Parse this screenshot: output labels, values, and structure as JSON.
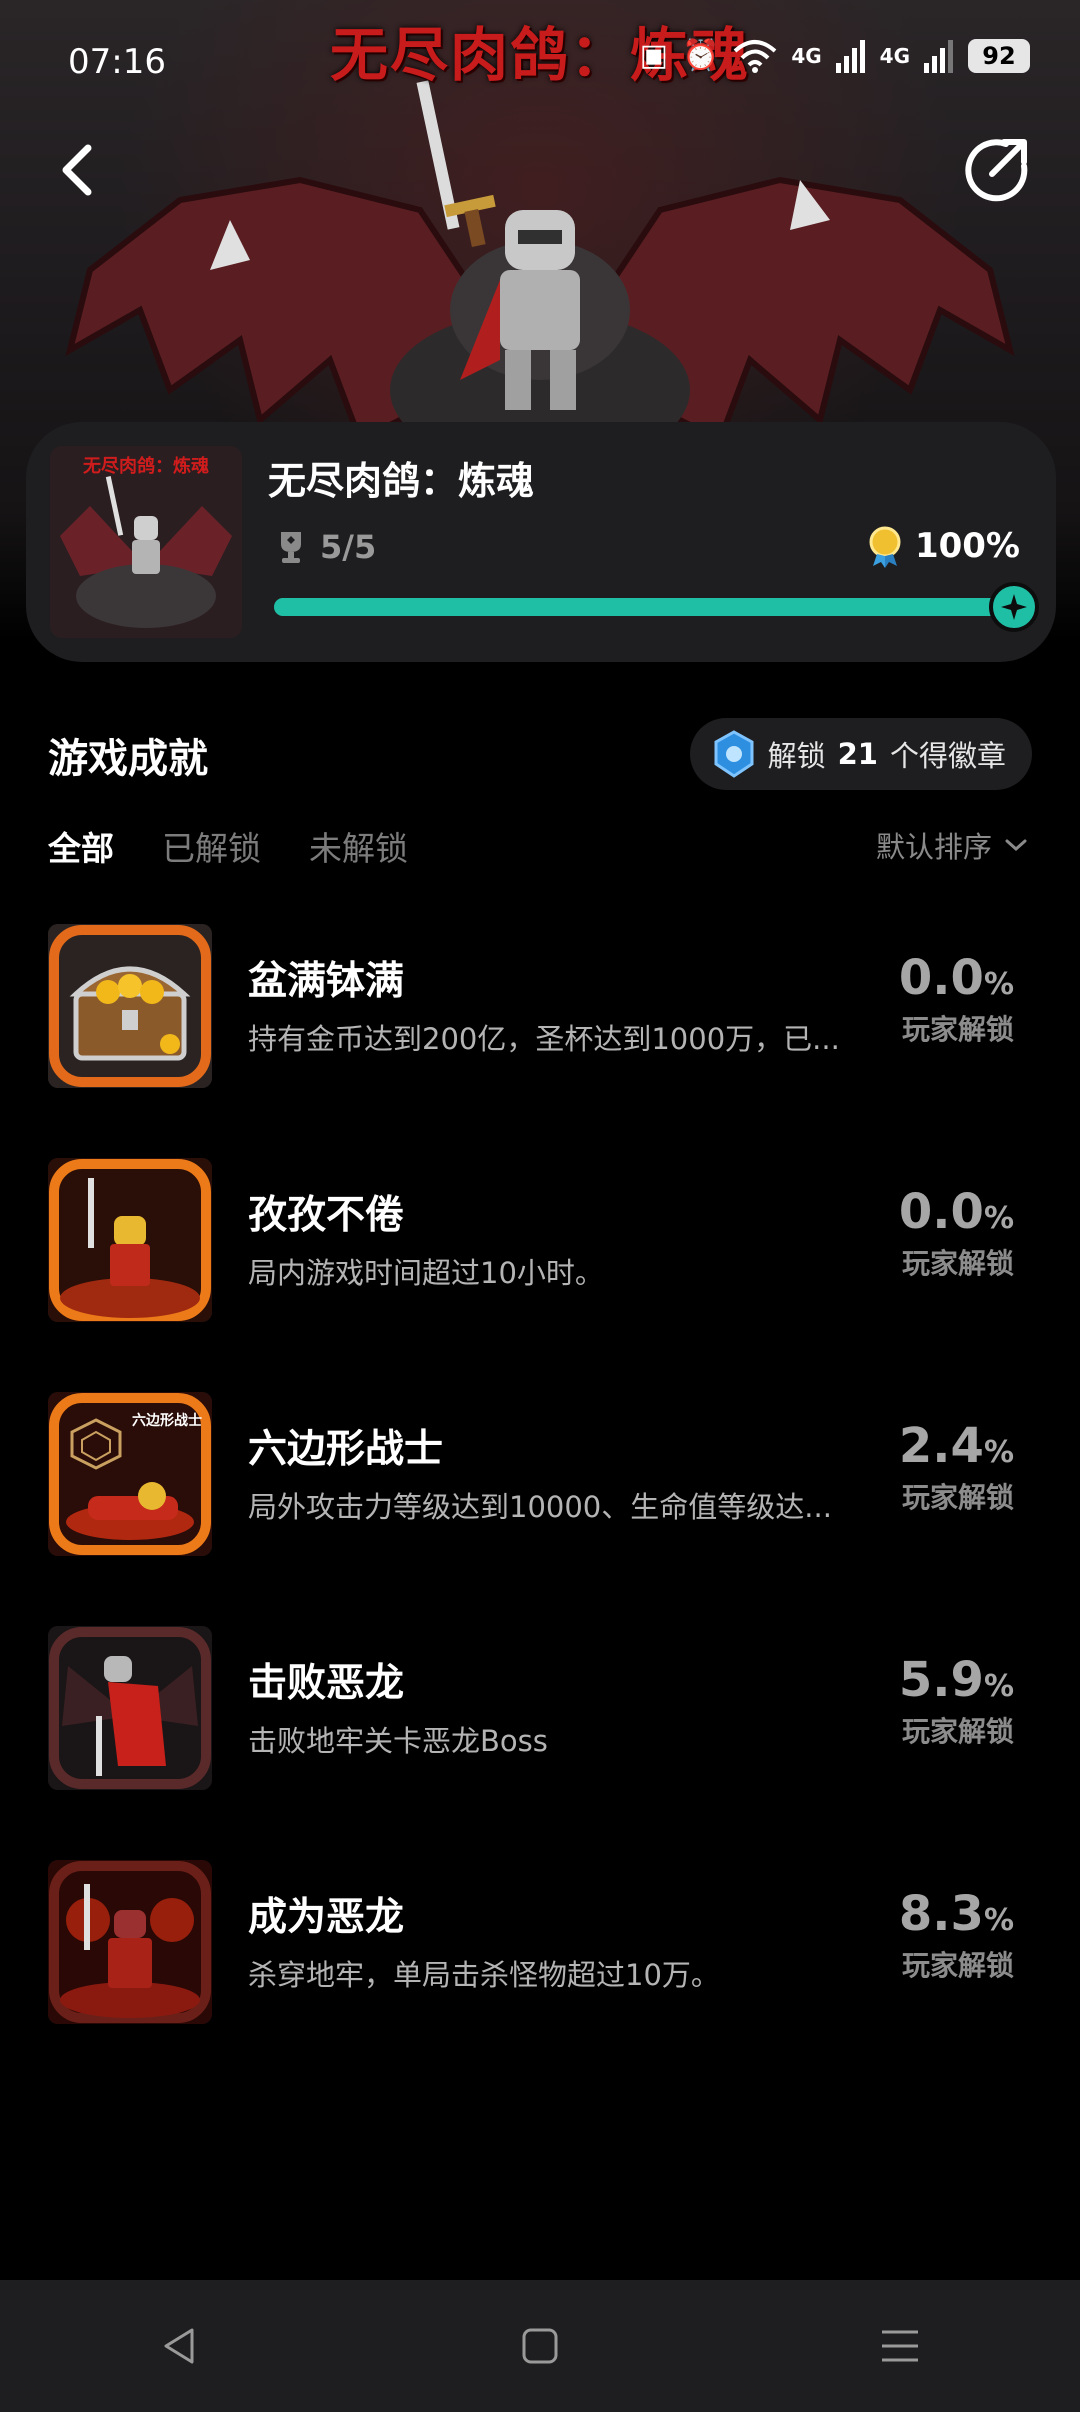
{
  "status_bar": {
    "time": "07:16",
    "battery": "92",
    "signal1": "4G",
    "signal2": "4G"
  },
  "hero": {
    "title": "无尽肉鸽：炼魂"
  },
  "game": {
    "thumb_caption": "无尽肉鸽：炼魂",
    "name": "无尽肉鸽：炼魂",
    "trophy_count": "5/5",
    "completion": "100%",
    "progress": 1.0,
    "accent_color": "#1fbfa6"
  },
  "section": {
    "title": "游戏成就",
    "badge_prefix": "解锁",
    "badge_count": "21",
    "badge_suffix": "个得徽章"
  },
  "tabs": [
    {
      "label": "全部",
      "active": true
    },
    {
      "label": "已解锁",
      "active": false
    },
    {
      "label": "未解锁",
      "active": false
    }
  ],
  "sort_label": "默认排序",
  "achievements": [
    {
      "title": "盆满钵满",
      "desc": "持有金币达到200亿，圣杯达到1000万，已...",
      "rate": "0.0",
      "unit": "%",
      "label": "玩家解锁",
      "icon": "treasure-chest-icon"
    },
    {
      "title": "孜孜不倦",
      "desc": "局内游戏时间超过10小时。",
      "rate": "0.0",
      "unit": "%",
      "label": "玩家解锁",
      "icon": "golden-knight-icon"
    },
    {
      "title": "六边形战士",
      "desc": "局外攻击力等级达到10000、生命值等级达...",
      "rate": "2.4",
      "unit": "%",
      "label": "玩家解锁",
      "icon": "hexagon-warrior-icon",
      "icon_text": "六边形战士"
    },
    {
      "title": "击败恶龙",
      "desc": "击败地牢关卡恶龙Boss",
      "rate": "5.9",
      "unit": "%",
      "label": "玩家解锁",
      "icon": "dragon-slayer-icon"
    },
    {
      "title": "成为恶龙",
      "desc": "杀穿地牢，单局击杀怪物超过10万。",
      "rate": "8.3",
      "unit": "%",
      "label": "玩家解锁",
      "icon": "fire-knight-icon"
    }
  ],
  "nav": {
    "back": "back-triangle-icon",
    "home": "home-square-icon",
    "menu": "menu-lines-icon"
  }
}
